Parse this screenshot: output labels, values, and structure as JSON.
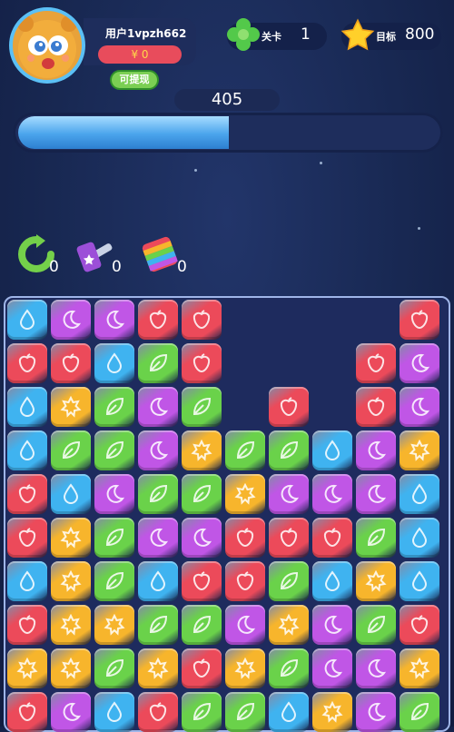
{
  "user": {
    "name": "用户1vpzh662",
    "money": "¥ 0",
    "withdraw_label": "可提现"
  },
  "level": {
    "label": "关卡",
    "value": "1"
  },
  "target": {
    "label": "目标",
    "value": "800"
  },
  "score": "405",
  "progress": 0.5,
  "tools": [
    {
      "name": "refresh-tool",
      "count": "0"
    },
    {
      "name": "hammer-tool",
      "count": "0"
    },
    {
      "name": "rainbow-tool",
      "count": "0"
    }
  ],
  "colors": {
    "blue": "#3fb3f0",
    "purple": "#c056e6",
    "red": "#ec4a5a",
    "green": "#6ad24a",
    "yellow": "#f7b52c"
  },
  "board": [
    "BPPRR....R",
    "RRBGR...RP",
    "BYGPG.R.RP",
    "BGGPYGGBPY",
    "RBPGGYPPPB",
    "RYGPPRRRGB",
    "BYGBRRGBYB",
    "RYYGGPYPGR",
    "YYGYRYGPPY",
    "RPBRGGBYPG"
  ]
}
